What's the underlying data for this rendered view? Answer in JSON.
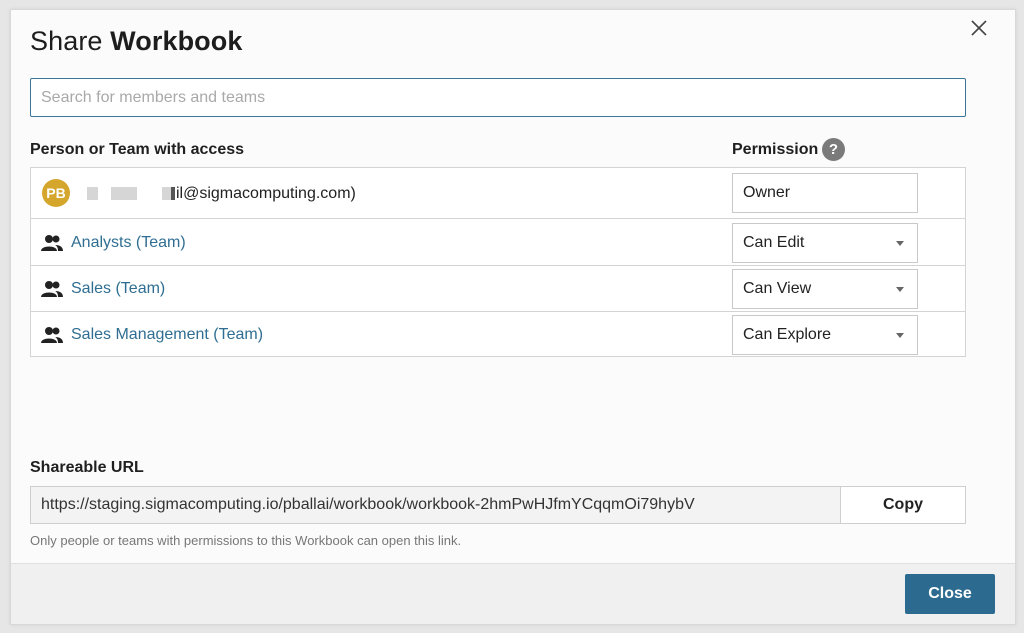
{
  "dialog": {
    "title_prefix": "Share ",
    "title_bold": "Workbook"
  },
  "search": {
    "placeholder": "Search for members and teams",
    "value": ""
  },
  "columns": {
    "person": "Person or Team with access",
    "permission": "Permission",
    "help_icon": "?"
  },
  "owner_row": {
    "initials": "PB",
    "email_visible": "il@sigmacomputing.com)",
    "permission": "Owner"
  },
  "team_rows": [
    {
      "name": "Analysts (Team)",
      "permission": "Can Edit",
      "icon": "team-icon"
    },
    {
      "name": "Sales (Team)",
      "permission": "Can View",
      "icon": "team-icon"
    },
    {
      "name": "Sales Management (Team)",
      "permission": "Can Explore",
      "icon": "team-icon"
    }
  ],
  "share": {
    "label": "Shareable URL",
    "url": "https://staging.sigmacomputing.io/pballai/workbook/workbook-2hmPwHJfmYCqqmOi79hybV",
    "copy_label": "Copy",
    "hint": "Only people or teams with permissions to this Workbook can open this link."
  },
  "footer": {
    "close_label": "Close"
  },
  "colors": {
    "accent": "#2c6b8f",
    "link": "#2f6e92",
    "avatar": "#d4a72c"
  }
}
